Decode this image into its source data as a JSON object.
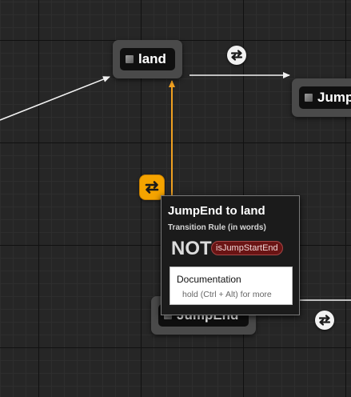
{
  "graph": {
    "states": [
      {
        "id": "land",
        "label": "land"
      },
      {
        "id": "jumpstart",
        "label": "JumpStart"
      },
      {
        "id": "jumpend",
        "label": "JumpEnd"
      }
    ],
    "transition_icon_name": "transition-arrows-icon",
    "selected_wire_color": "#f0a020",
    "wire_color": "#f2f2f2"
  },
  "tooltip": {
    "title": "JumpEnd to land",
    "subtitle": "Transition Rule (in words)",
    "not_label": "NOT",
    "variable": "isJumpStartEnd",
    "doc_title": "Documentation",
    "doc_hint": "hold (Ctrl + Alt) for more"
  }
}
